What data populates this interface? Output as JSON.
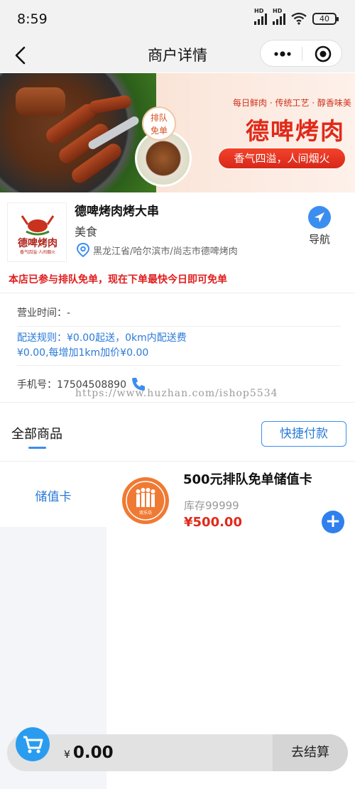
{
  "status_bar": {
    "time": "8:59",
    "signal1_label": "HD",
    "signal2_label": "HD",
    "battery": "40"
  },
  "nav": {
    "title": "商户详情"
  },
  "banner": {
    "badge": "排队\n免单",
    "slogan": "每日鲜肉 · 传统工艺 · 醇香味美",
    "brand": "德啤烤肉",
    "pill": "香气四溢，人间烟火"
  },
  "shop": {
    "logo_text": "德啤烤肉",
    "logo_sub": "香气四溢·人间烟火",
    "name": "德啤烤肉烤大串",
    "category": "美食",
    "address": "黑龙江省/哈尔滨市/尚志市德啤烤肉",
    "nav_label": "导航",
    "promo": "本店已参与排队免单，现在下单最快今日即可免单"
  },
  "info": {
    "hours": "营业时间：-",
    "delivery_line1": "配送规则：¥0.00起送，0km内配送费",
    "delivery_line2": "¥0.00,每增加1km加价¥0.00",
    "phone": "手机号：17504508890",
    "watermark": "https://www.huzhan.com/ishop5534"
  },
  "tabs": {
    "all": "全部商品",
    "quick_pay": "快捷付款"
  },
  "categories": [
    {
      "label": "储值卡"
    }
  ],
  "products": [
    {
      "name": "500元排队免单储值卡",
      "stock": "库存99999",
      "price": "¥500.00",
      "image_text": "DOUBLE HAPPINESS RESEARCH",
      "image_sub": "双乐坊"
    }
  ],
  "cart": {
    "currency": "¥",
    "amount": "0.00",
    "checkout": "去结算"
  },
  "colors": {
    "accent": "#3b8ef0",
    "price_red": "#e02a1a",
    "promo_red": "#e01e1e",
    "status_bg": "#f2f2f2",
    "sidebar_bg": "#f3f5f9"
  },
  "icons": [
    "back-arrow-icon",
    "more-dots-icon",
    "close-target-icon",
    "location-pin-icon",
    "navigation-arrow-icon",
    "phone-icon",
    "plus-icon",
    "shopping-cart-icon"
  ]
}
